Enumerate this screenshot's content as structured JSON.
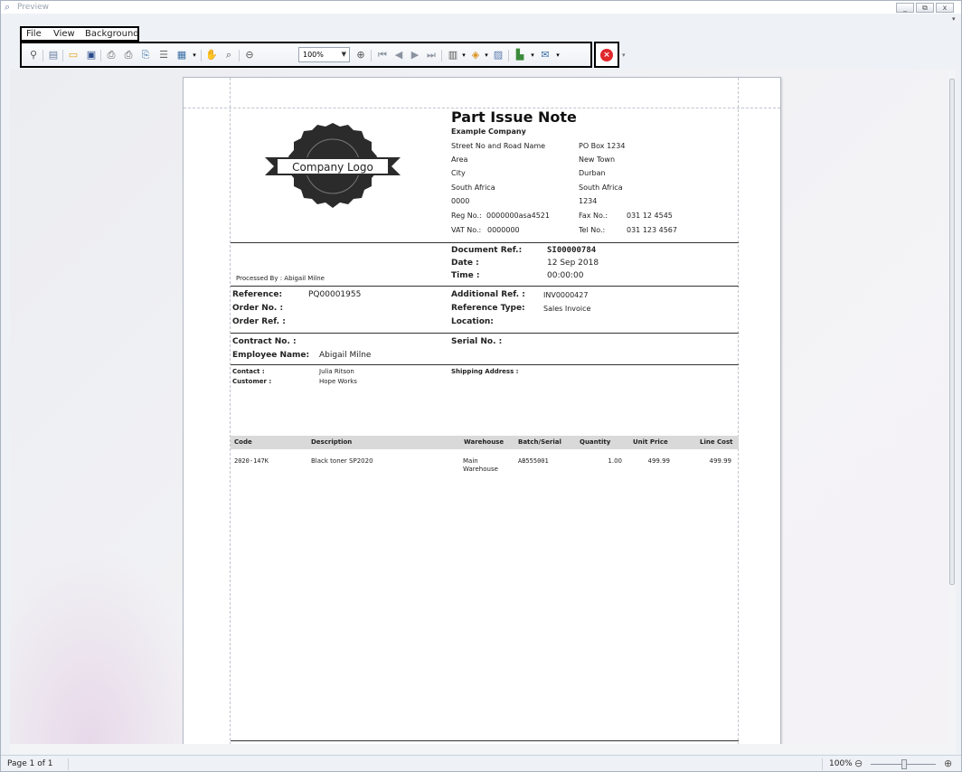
{
  "window": {
    "title": "Preview",
    "min": "_",
    "restore": "⧉",
    "close": "x"
  },
  "menu": {
    "file": "File",
    "view": "View",
    "background": "Background"
  },
  "toolbar": {
    "zoom": "100%"
  },
  "document": {
    "title": "Part Issue Note",
    "logo_text": "Company Logo",
    "company": "Example Company",
    "addr_left": [
      "Street No and Road Name",
      "Area",
      "City",
      "South Africa",
      "0000"
    ],
    "addr_right": [
      "PO Box 1234",
      "New Town",
      "Durban",
      "South Africa",
      "1234"
    ],
    "reg_label": "Reg No.:",
    "reg_value": "0000000asa4521",
    "fax_label": "Fax No.:",
    "fax_value": "031 12 4545",
    "vat_label": "VAT No.:",
    "vat_value": "0000000",
    "tel_label": "Tel No.:",
    "tel_value": "031 123 4567",
    "docref_label": "Document Ref.:",
    "docref_value": "SI00000784",
    "date_label": "Date :",
    "date_value": "12 Sep 2018",
    "time_label": "Time :",
    "time_value": "00:00:00",
    "processed_by": "Processed By : Abigail Milne",
    "reference_label": "Reference:",
    "reference_value": "PQ00001955",
    "orderno_label": "Order No. :",
    "orderref_label": "Order Ref. :",
    "addref_label": "Additional Ref. :",
    "addref_value": "INV0000427",
    "reftype_label": "Reference Type:",
    "reftype_value": "Sales Invoice",
    "location_label": "Location:",
    "contract_label": "Contract No. :",
    "serial_label": "Serial No. :",
    "employee_label": "Employee Name:",
    "employee_value": "Abigail Milne",
    "contact_label": "Contact :",
    "contact_value": "Julia Ritson",
    "customer_label": "Customer :",
    "customer_value": "Hope Works",
    "shipping_label": "Shipping Address :",
    "table": {
      "headers": [
        "Code",
        "Description",
        "Warehouse",
        "Batch/Serial",
        "Quantity",
        "Unit Price",
        "Line Cost"
      ],
      "rows": [
        {
          "code": "2020-147K",
          "description": "Black toner SP2020",
          "warehouse1": "Main",
          "warehouse2": "Warehouse",
          "batch": "AB555001",
          "quantity": "1.00",
          "unit_price": "499.99",
          "line_cost": "499.99"
        }
      ]
    }
  },
  "status": {
    "page": "Page 1 of 1",
    "zoom": "100%"
  },
  "colors": {
    "accent_close": "#e0282d",
    "frame": "#a9b4c2"
  }
}
